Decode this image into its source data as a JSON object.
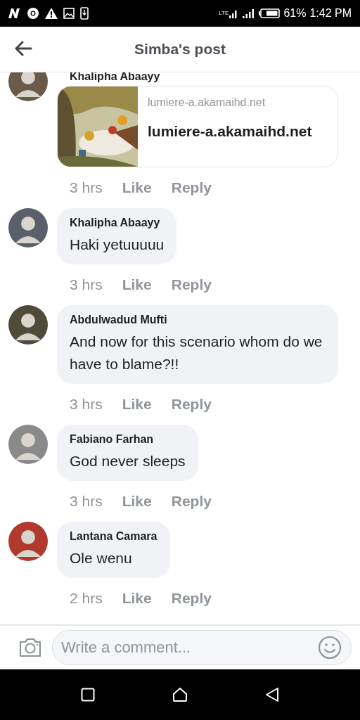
{
  "status_bar": {
    "network": "LTE",
    "battery": "61%",
    "time": "1:42 PM"
  },
  "header": {
    "title": "Simba's post"
  },
  "comments": [
    {
      "kind": "link",
      "author": "Khalipha Abaayy",
      "link": {
        "domain": "lumiere-a.akamaihd.net",
        "title": "lumiere-a.akamaihd.net"
      },
      "time": "3 hrs",
      "like": "Like",
      "reply": "Reply"
    },
    {
      "kind": "text",
      "author": "Khalipha Abaayy",
      "text": "Haki yetuuuuu",
      "time": "3 hrs",
      "like": "Like",
      "reply": "Reply"
    },
    {
      "kind": "text",
      "author": "Abdulwadud Mufti",
      "text": "And now for this scenario whom do we have to blame?!!",
      "time": "3 hrs",
      "like": "Like",
      "reply": "Reply"
    },
    {
      "kind": "text",
      "author": "Fabiano Farhan",
      "text": "God never sleeps",
      "time": "3 hrs",
      "like": "Like",
      "reply": "Reply"
    },
    {
      "kind": "text",
      "author": "Lantana Camara",
      "text": "Ole wenu",
      "time": "2 hrs",
      "like": "Like",
      "reply": "Reply"
    }
  ],
  "composer": {
    "placeholder": "Write a comment..."
  }
}
